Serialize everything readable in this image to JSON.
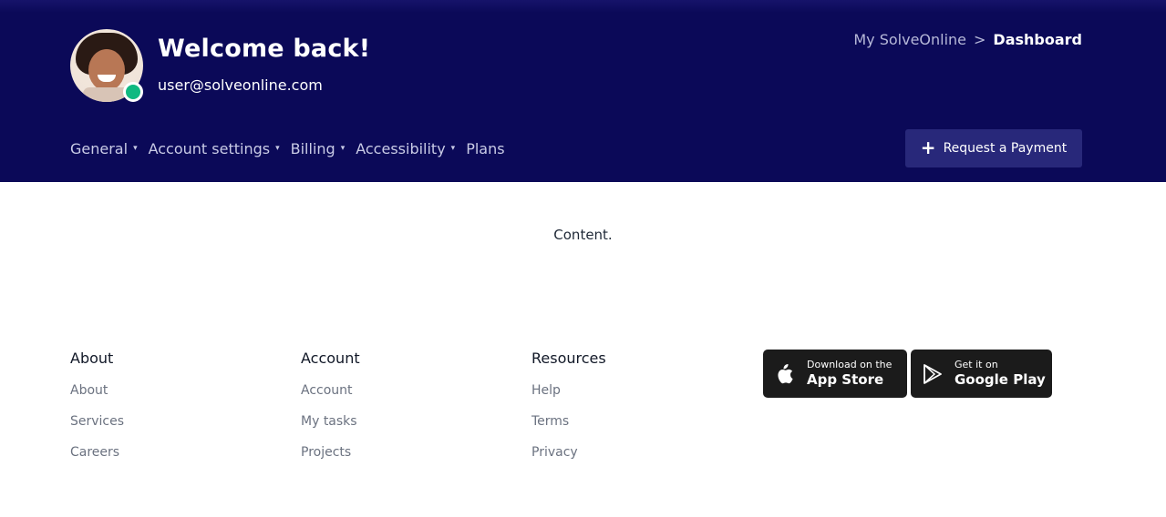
{
  "header": {
    "welcome": "Welcome back!",
    "email": "user@solveonline.com",
    "breadcrumb": {
      "parent": "My SolveOnline",
      "separator": ">",
      "current": "Dashboard"
    },
    "nav": [
      "General",
      "Account settings",
      "Billing",
      "Accessibility",
      "Plans"
    ],
    "request_button": "Request a Payment",
    "colors": {
      "background": "#0b0958",
      "status": "#10b981"
    }
  },
  "main": {
    "content": "Content."
  },
  "footer": {
    "columns": [
      {
        "title": "About",
        "links": [
          "About",
          "Services",
          "Careers"
        ]
      },
      {
        "title": "Account",
        "links": [
          "Account",
          "My tasks",
          "Projects"
        ]
      },
      {
        "title": "Resources",
        "links": [
          "Help",
          "Terms",
          "Privacy"
        ]
      }
    ],
    "app_store": {
      "small": "Download on the",
      "big": "App Store",
      "icon": "apple-icon"
    },
    "google_play": {
      "small": "Get it on",
      "big": "Google Play",
      "icon": "play-store-icon"
    }
  }
}
